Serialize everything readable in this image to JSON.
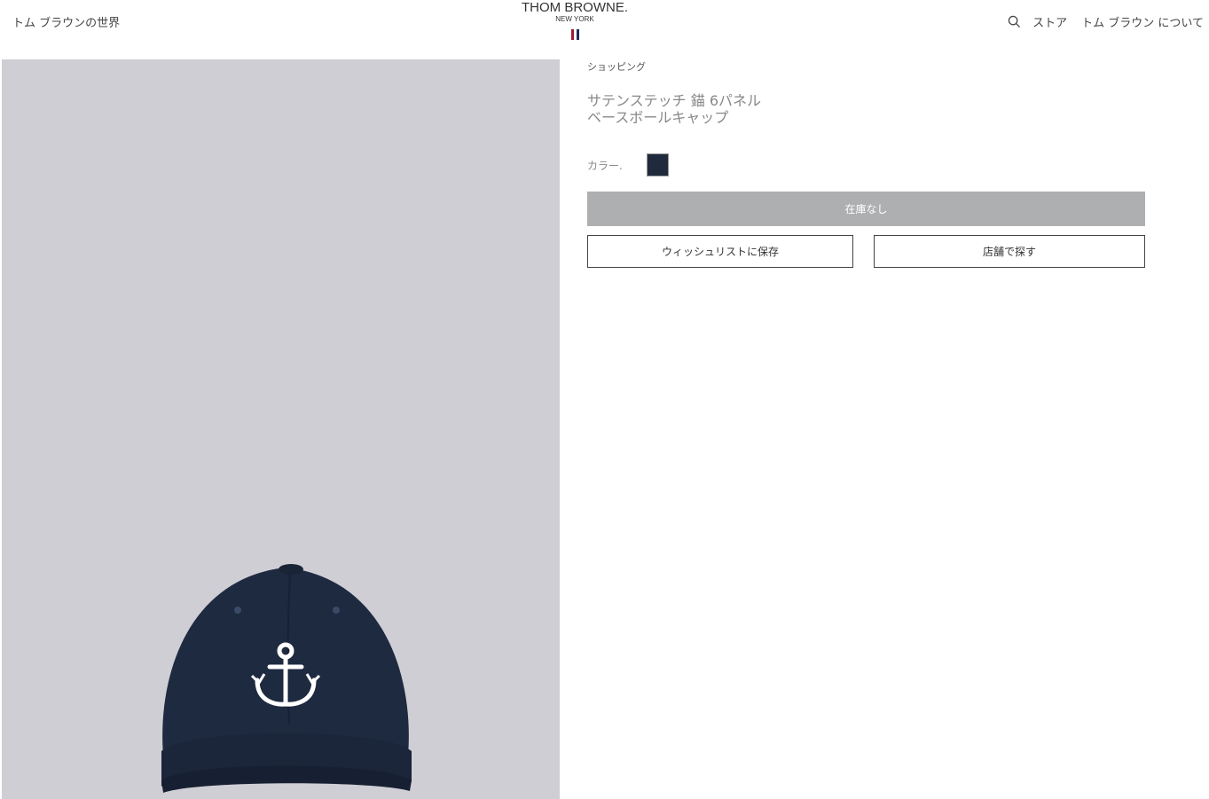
{
  "header": {
    "world_link": "トム ブラウンの世界",
    "logo_main": "THOM BROWNE.",
    "logo_sub": "NEW YORK",
    "store_link": "ストア",
    "about_link": "トム ブラウン について",
    "icons": {
      "search": "search-icon"
    },
    "flag_colors": [
      "#9b1b30",
      "#ffffff",
      "#1e2a5a"
    ]
  },
  "product": {
    "breadcrumb": "ショッピング",
    "title": "サテンステッチ 錨 6パネル ベースボールキャップ",
    "color_label": "カラー.",
    "swatch_color": "#1f2a3c",
    "out_of_stock_label": "在庫なし",
    "wishlist_label": "ウィッシュリストに保存",
    "find_store_label": "店舗で探す"
  },
  "colors": {
    "image_bg": "#cfced4",
    "cap": "#1e2a40",
    "button_disabled": "#aeafb1"
  }
}
